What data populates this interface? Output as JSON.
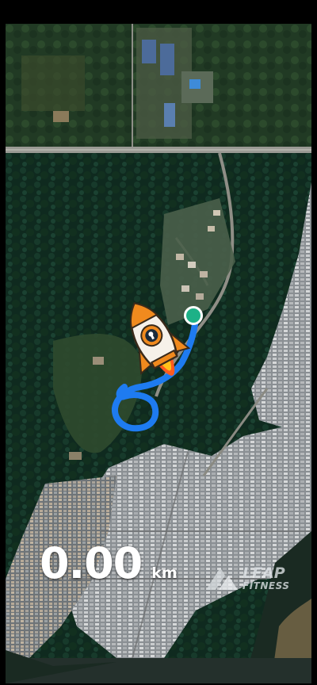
{
  "tracker": {
    "distance_value": "0.00",
    "distance_unit": "km"
  },
  "watermark": {
    "line1": "LEAP",
    "line2": "FITNESS"
  },
  "map": {
    "type": "satellite",
    "route_color": "#1e7bf0",
    "start_marker_color": "#1db187"
  },
  "avatar": {
    "icon": "rocket-icon",
    "colors": {
      "body": "#f6f1e9",
      "accent": "#f08a1e",
      "window": "#1a2a3a",
      "flame": "#ff5a1f"
    }
  }
}
